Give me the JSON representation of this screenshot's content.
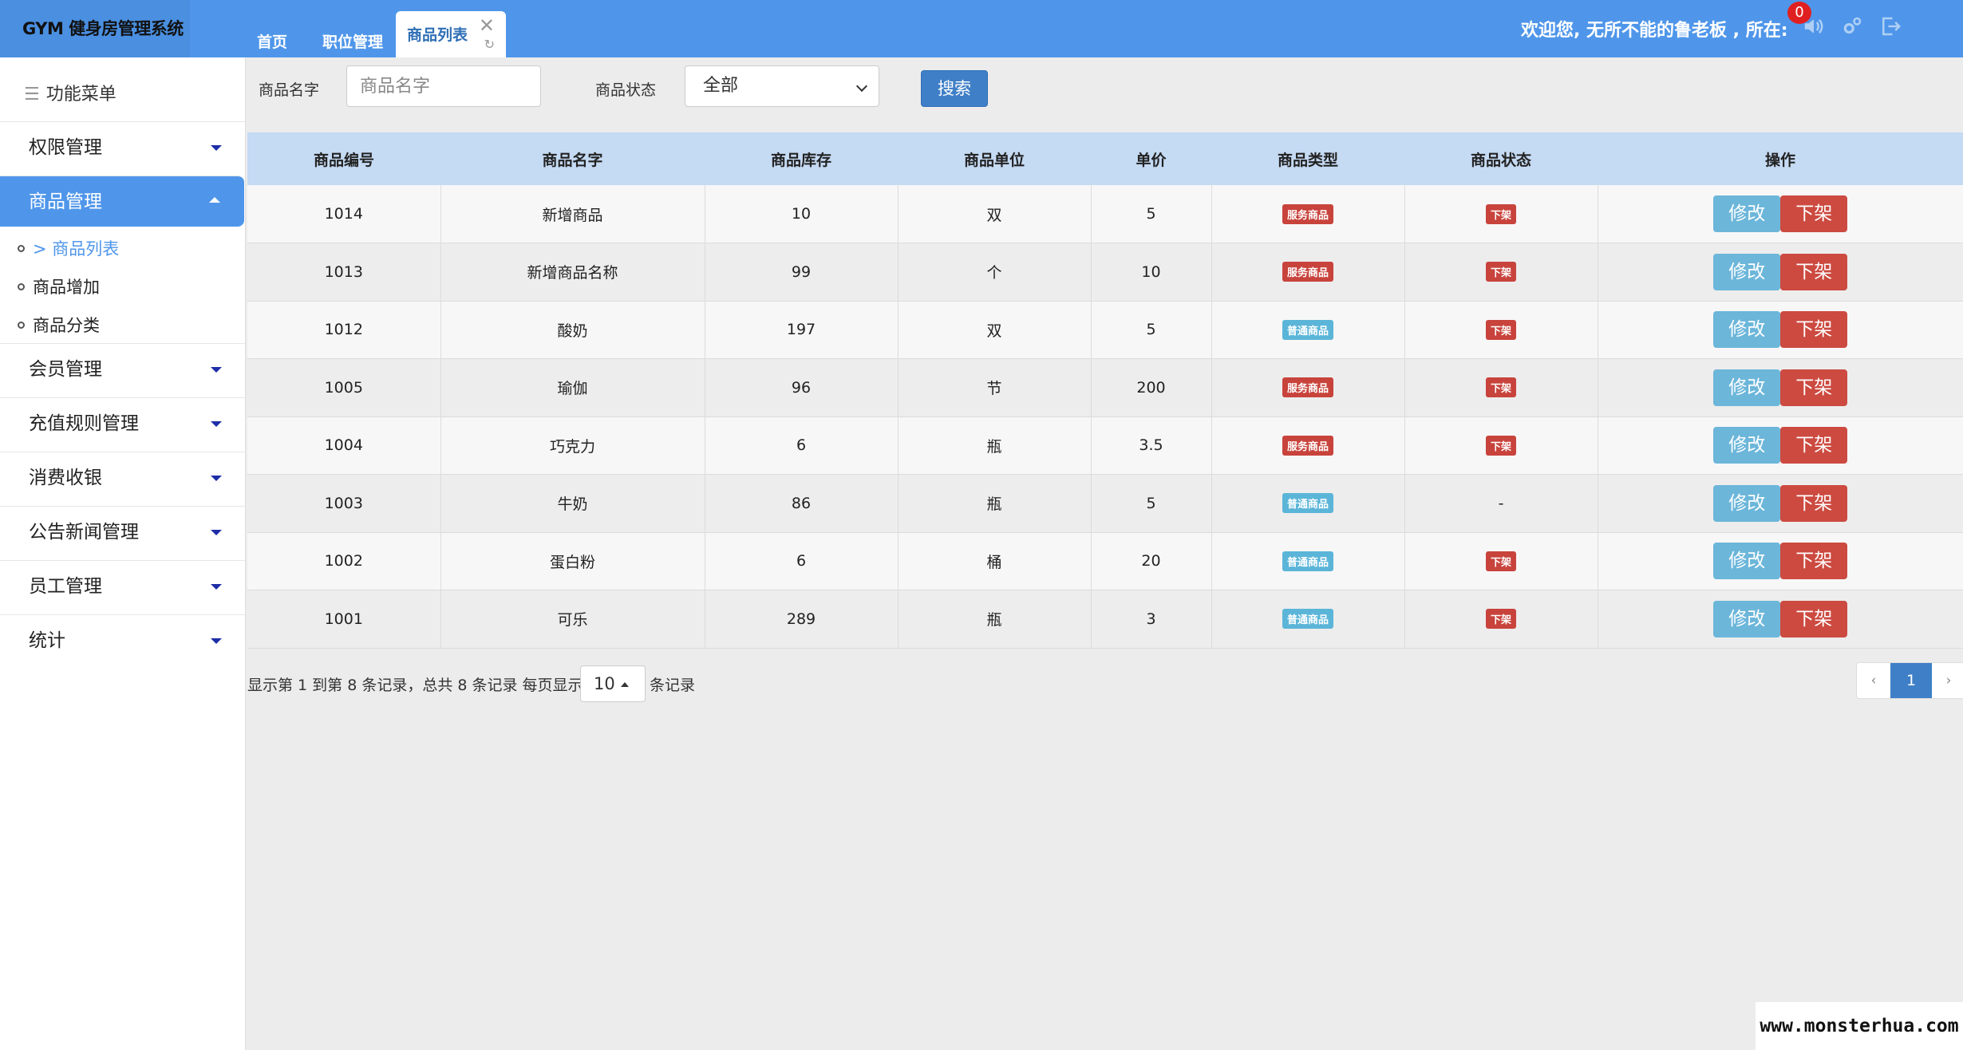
{
  "app": {
    "brand": "GYM 健身房管理系统",
    "welcome": "欢迎您, 无所不能的鲁老板 , 所在:",
    "notification_count": "0"
  },
  "tabs": [
    {
      "label": "首页"
    },
    {
      "label": "职位管理"
    },
    {
      "label": "商品列表",
      "close": "✕",
      "refresh": "↻"
    }
  ],
  "sidebar": {
    "title": "功能菜单",
    "items": [
      {
        "label": "权限管理"
      },
      {
        "label": "商品管理"
      },
      {
        "label": "会员管理"
      },
      {
        "label": "充值规则管理"
      },
      {
        "label": "消费收银"
      },
      {
        "label": "公告新闻管理"
      },
      {
        "label": "员工管理"
      },
      {
        "label": "统计"
      }
    ],
    "sub_items": [
      {
        "label": "> 商品列表"
      },
      {
        "label": "商品增加"
      },
      {
        "label": "商品分类"
      }
    ]
  },
  "search": {
    "name_label": "商品名字",
    "name_placeholder": "商品名字",
    "status_label": "商品状态",
    "status_value": "全部",
    "button": "搜索"
  },
  "table": {
    "headers": [
      "商品编号",
      "商品名字",
      "商品库存",
      "商品单位",
      "单价",
      "商品类型",
      "商品状态",
      "操作"
    ],
    "rows": [
      {
        "id": "1014",
        "name": "新增商品",
        "stock": "10",
        "unit": "双",
        "price": "5",
        "type": "服务商品",
        "status": "下架"
      },
      {
        "id": "1013",
        "name": "新增商品名称",
        "stock": "99",
        "unit": "个",
        "price": "10",
        "type": "服务商品",
        "status": "下架"
      },
      {
        "id": "1012",
        "name": "酸奶",
        "stock": "197",
        "unit": "双",
        "price": "5",
        "type": "普通商品",
        "status": "下架"
      },
      {
        "id": "1005",
        "name": "瑜伽",
        "stock": "96",
        "unit": "节",
        "price": "200",
        "type": "服务商品",
        "status": "下架"
      },
      {
        "id": "1004",
        "name": "巧克力",
        "stock": "6",
        "unit": "瓶",
        "price": "3.5",
        "type": "服务商品",
        "status": "下架"
      },
      {
        "id": "1003",
        "name": "牛奶",
        "stock": "86",
        "unit": "瓶",
        "price": "5",
        "type": "普通商品",
        "status": "-"
      },
      {
        "id": "1002",
        "name": "蛋白粉",
        "stock": "6",
        "unit": "桶",
        "price": "20",
        "type": "普通商品",
        "status": "下架"
      },
      {
        "id": "1001",
        "name": "可乐",
        "stock": "289",
        "unit": "瓶",
        "price": "3",
        "type": "普通商品",
        "status": "下架"
      }
    ],
    "edit_label": "修改",
    "off_label": "下架"
  },
  "footer": {
    "info": "显示第 1 到第 8 条记录，总共 8 条记录  每页显示",
    "page_size": "10",
    "suffix": "条记录",
    "prev": "‹",
    "current_page": "1",
    "next": "›"
  },
  "watermark": "www.monsterhua.com",
  "colors": {
    "accent": "#4f96ea",
    "danger": "#c8433c",
    "info": "#5bb5d8"
  }
}
